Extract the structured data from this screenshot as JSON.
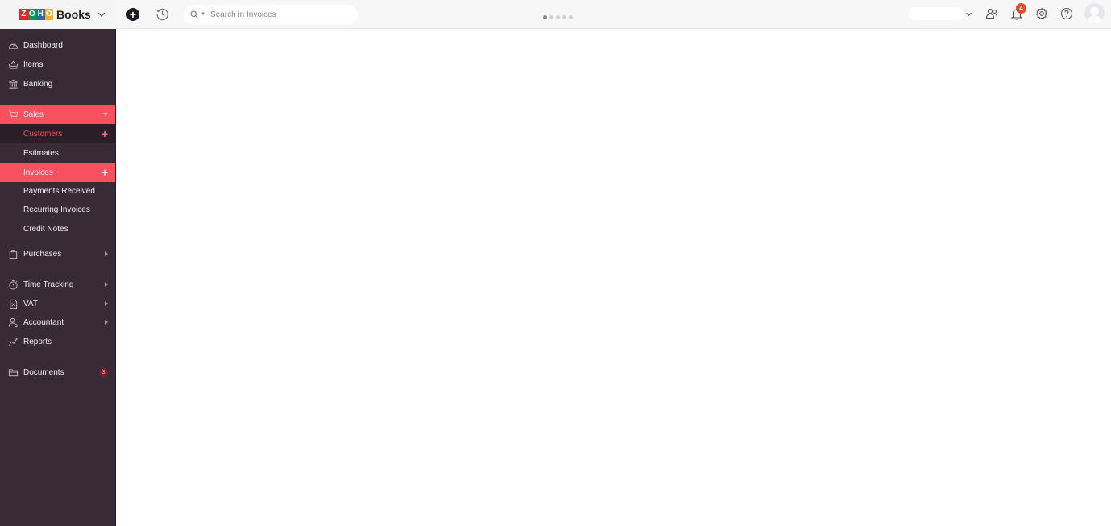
{
  "brand": {
    "zoho_letters": [
      "Z",
      "O",
      "H",
      "O"
    ],
    "zoho_colors": [
      "#e42527",
      "#089949",
      "#226db4",
      "#f9b21d"
    ],
    "product": "Books"
  },
  "topbar": {
    "search_placeholder": "Search in Invoices",
    "loader_dots": 5,
    "notification_count": "4"
  },
  "sidebar": {
    "items": [
      {
        "label": "Dashboard",
        "icon": "dashboard-icon"
      },
      {
        "label": "Items",
        "icon": "basket-icon"
      },
      {
        "label": "Banking",
        "icon": "bank-icon"
      },
      {
        "label": "Sales",
        "icon": "cart-icon",
        "expanded": true
      },
      {
        "label": "Customers",
        "plus": true
      },
      {
        "label": "Estimates"
      },
      {
        "label": "Invoices",
        "plus": true,
        "active": true
      },
      {
        "label": "Payments Received"
      },
      {
        "label": "Recurring Invoices"
      },
      {
        "label": "Credit Notes"
      },
      {
        "label": "Purchases",
        "icon": "bag-icon",
        "submenu": true
      },
      {
        "label": "Time Tracking",
        "icon": "stopwatch-icon",
        "submenu": true
      },
      {
        "label": "VAT",
        "icon": "tax-document-icon",
        "submenu": true
      },
      {
        "label": "Accountant",
        "icon": "accountant-icon",
        "submenu": true
      },
      {
        "label": "Reports",
        "icon": "reports-icon"
      },
      {
        "label": "Documents",
        "icon": "folder-icon",
        "badge": "3"
      }
    ]
  },
  "colors": {
    "accent": "#f5515f",
    "sidebar_bg": "#392a37",
    "notification_badge": "#e44b2b"
  }
}
